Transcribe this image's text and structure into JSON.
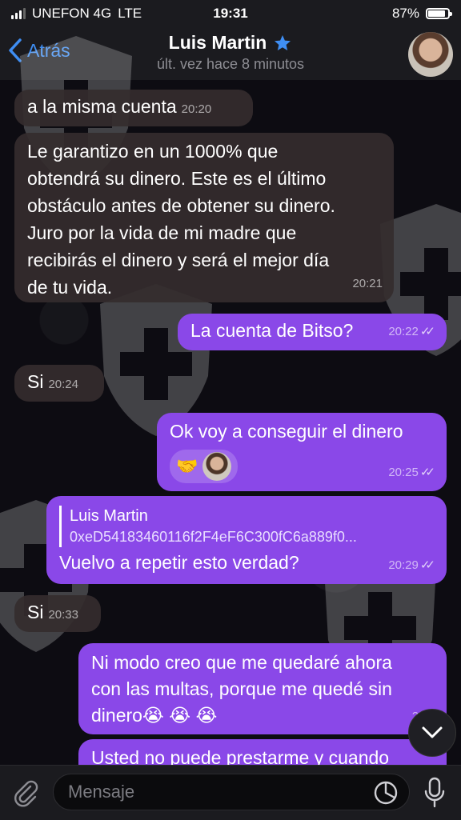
{
  "status_bar": {
    "carrier": "UNEFON 4G",
    "network": "LTE",
    "time": "19:31",
    "battery": "87%",
    "battery_level": 0.87
  },
  "header": {
    "back_label": "Atrás",
    "contact_name": "Luis Martin",
    "last_seen": "últ. vez hace 8 minutos"
  },
  "messages": [
    {
      "dir": "in",
      "text": "a la misma cuenta",
      "time": "20:20"
    },
    {
      "dir": "in",
      "lines": [
        "Le garantizo en un 1000% que",
        "obtendrá su dinero. Este es el último",
        "obstáculo antes de obtener su dinero.",
        "Juro por la vida de mi madre que",
        "recibirás el dinero y será el mejor día",
        "de tu vida."
      ],
      "time": "20:21"
    },
    {
      "dir": "out",
      "text": "La cuenta de Bitso?",
      "time": "20:22"
    },
    {
      "dir": "in",
      "text": "Si",
      "time": "20:24"
    },
    {
      "dir": "out",
      "text": "Ok voy a conseguir el dinero",
      "time": "20:25",
      "reaction": "🤝"
    },
    {
      "dir": "out",
      "reply_name": "Luis Martin",
      "reply_text": "0xeD54183460116f2F4eF6C300fC6a889f0...",
      "text": "Vuelvo a repetir esto verdad?",
      "time": "20:29"
    },
    {
      "dir": "in",
      "text": "Si",
      "time": "20:33"
    },
    {
      "dir": "out",
      "lines": [
        "Ni modo creo que me quedaré ahora",
        "con las multas, porque me quedé sin",
        "dinero😭 😭 😭"
      ],
      "time": "20:3"
    },
    {
      "dir": "out",
      "text": "Usted no puede prestarme y cuando"
    }
  ],
  "input": {
    "placeholder": "Mensaje"
  },
  "colors": {
    "accent": "#3f8ef3",
    "outgoing_bubble": "#8a48e8",
    "incoming_bubble": "#342c2e",
    "bar_bg": "#1b1b1f"
  }
}
